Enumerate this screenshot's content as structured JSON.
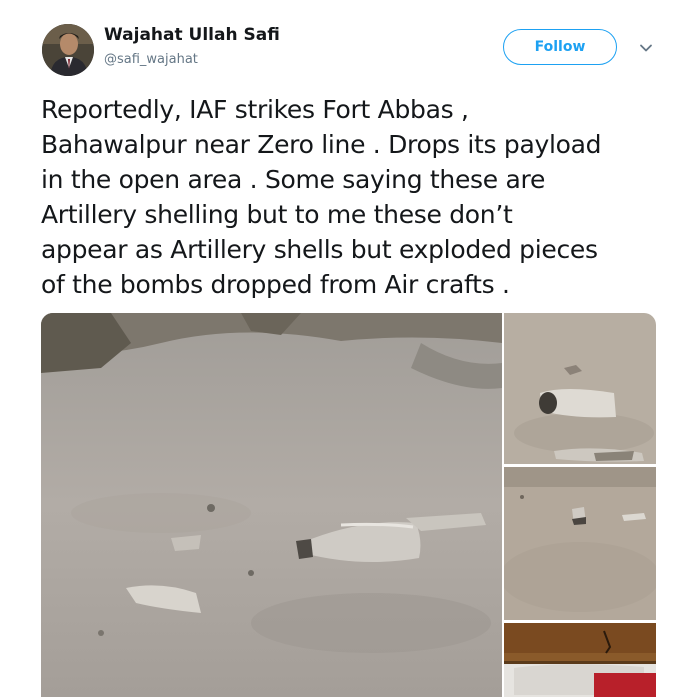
{
  "tweet": {
    "author": {
      "display_name": "Wajahat Ullah Safi",
      "handle": "@safi_wajahat",
      "avatar_icon": "user-avatar"
    },
    "follow_label": "Follow",
    "menu_icon": "chevron-down-icon",
    "text": "Reportedly, IAF strikes Fort Abbas ,\nBahawalpur near Zero line . Drops its payload\nin the open area . Some saying these are\nArtillery shelling but to me these don’t\nappear as Artillery shells but exploded pieces\nof the bombs dropped from Air crafts .",
    "media": {
      "photo_count": 4
    }
  },
  "colors": {
    "accent": "#1da1f2",
    "text_primary": "#14171a",
    "text_secondary": "#657786"
  }
}
